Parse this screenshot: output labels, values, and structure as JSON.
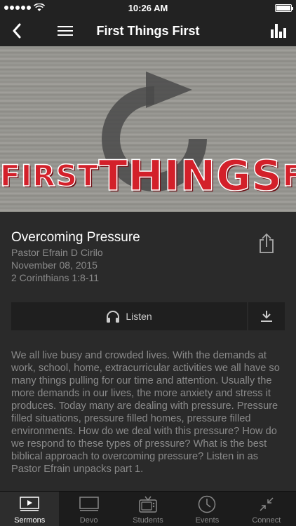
{
  "status_bar": {
    "time": "10:26 AM"
  },
  "nav": {
    "title": "First Things First"
  },
  "hero": {
    "title_left": "FIRST",
    "title_middle": "THINGS",
    "title_right": "FIRST"
  },
  "sermon": {
    "title": "Overcoming Pressure",
    "pastor": "Pastor Efrain D Cirilo",
    "date": "November 08, 2015",
    "scripture": "2 Corinthians 1:8-11",
    "listen_label": "Listen",
    "description": "We all live busy and crowded lives. With the demands at work, school, home, extracurricular activities we all have so many things pulling for our time and attention. Usually the more demands in our lives, the more anxiety and stress it produces. Today many are dealing with pressure. Pressure filled situations, pressure filled homes, pressure filled environments. How do we deal with this pressure? How do we respond to these types of pressure? What is the best biblical approach to overcoming pressure?  Listen in as Pastor Efrain unpacks part 1."
  },
  "tabs": [
    {
      "label": "Sermons",
      "icon": "play-screen-icon",
      "active": true
    },
    {
      "label": "Devo",
      "icon": "monitor-icon",
      "active": false
    },
    {
      "label": "Students",
      "icon": "tv-icon",
      "active": false
    },
    {
      "label": "Events",
      "icon": "clock-icon",
      "active": false
    },
    {
      "label": "Connect",
      "icon": "collapse-arrows-icon",
      "active": false
    }
  ],
  "colors": {
    "background": "#2a2a2a",
    "bar": "#222222",
    "title_red": "#d3202a",
    "meta_gray": "#8a8a8a"
  }
}
